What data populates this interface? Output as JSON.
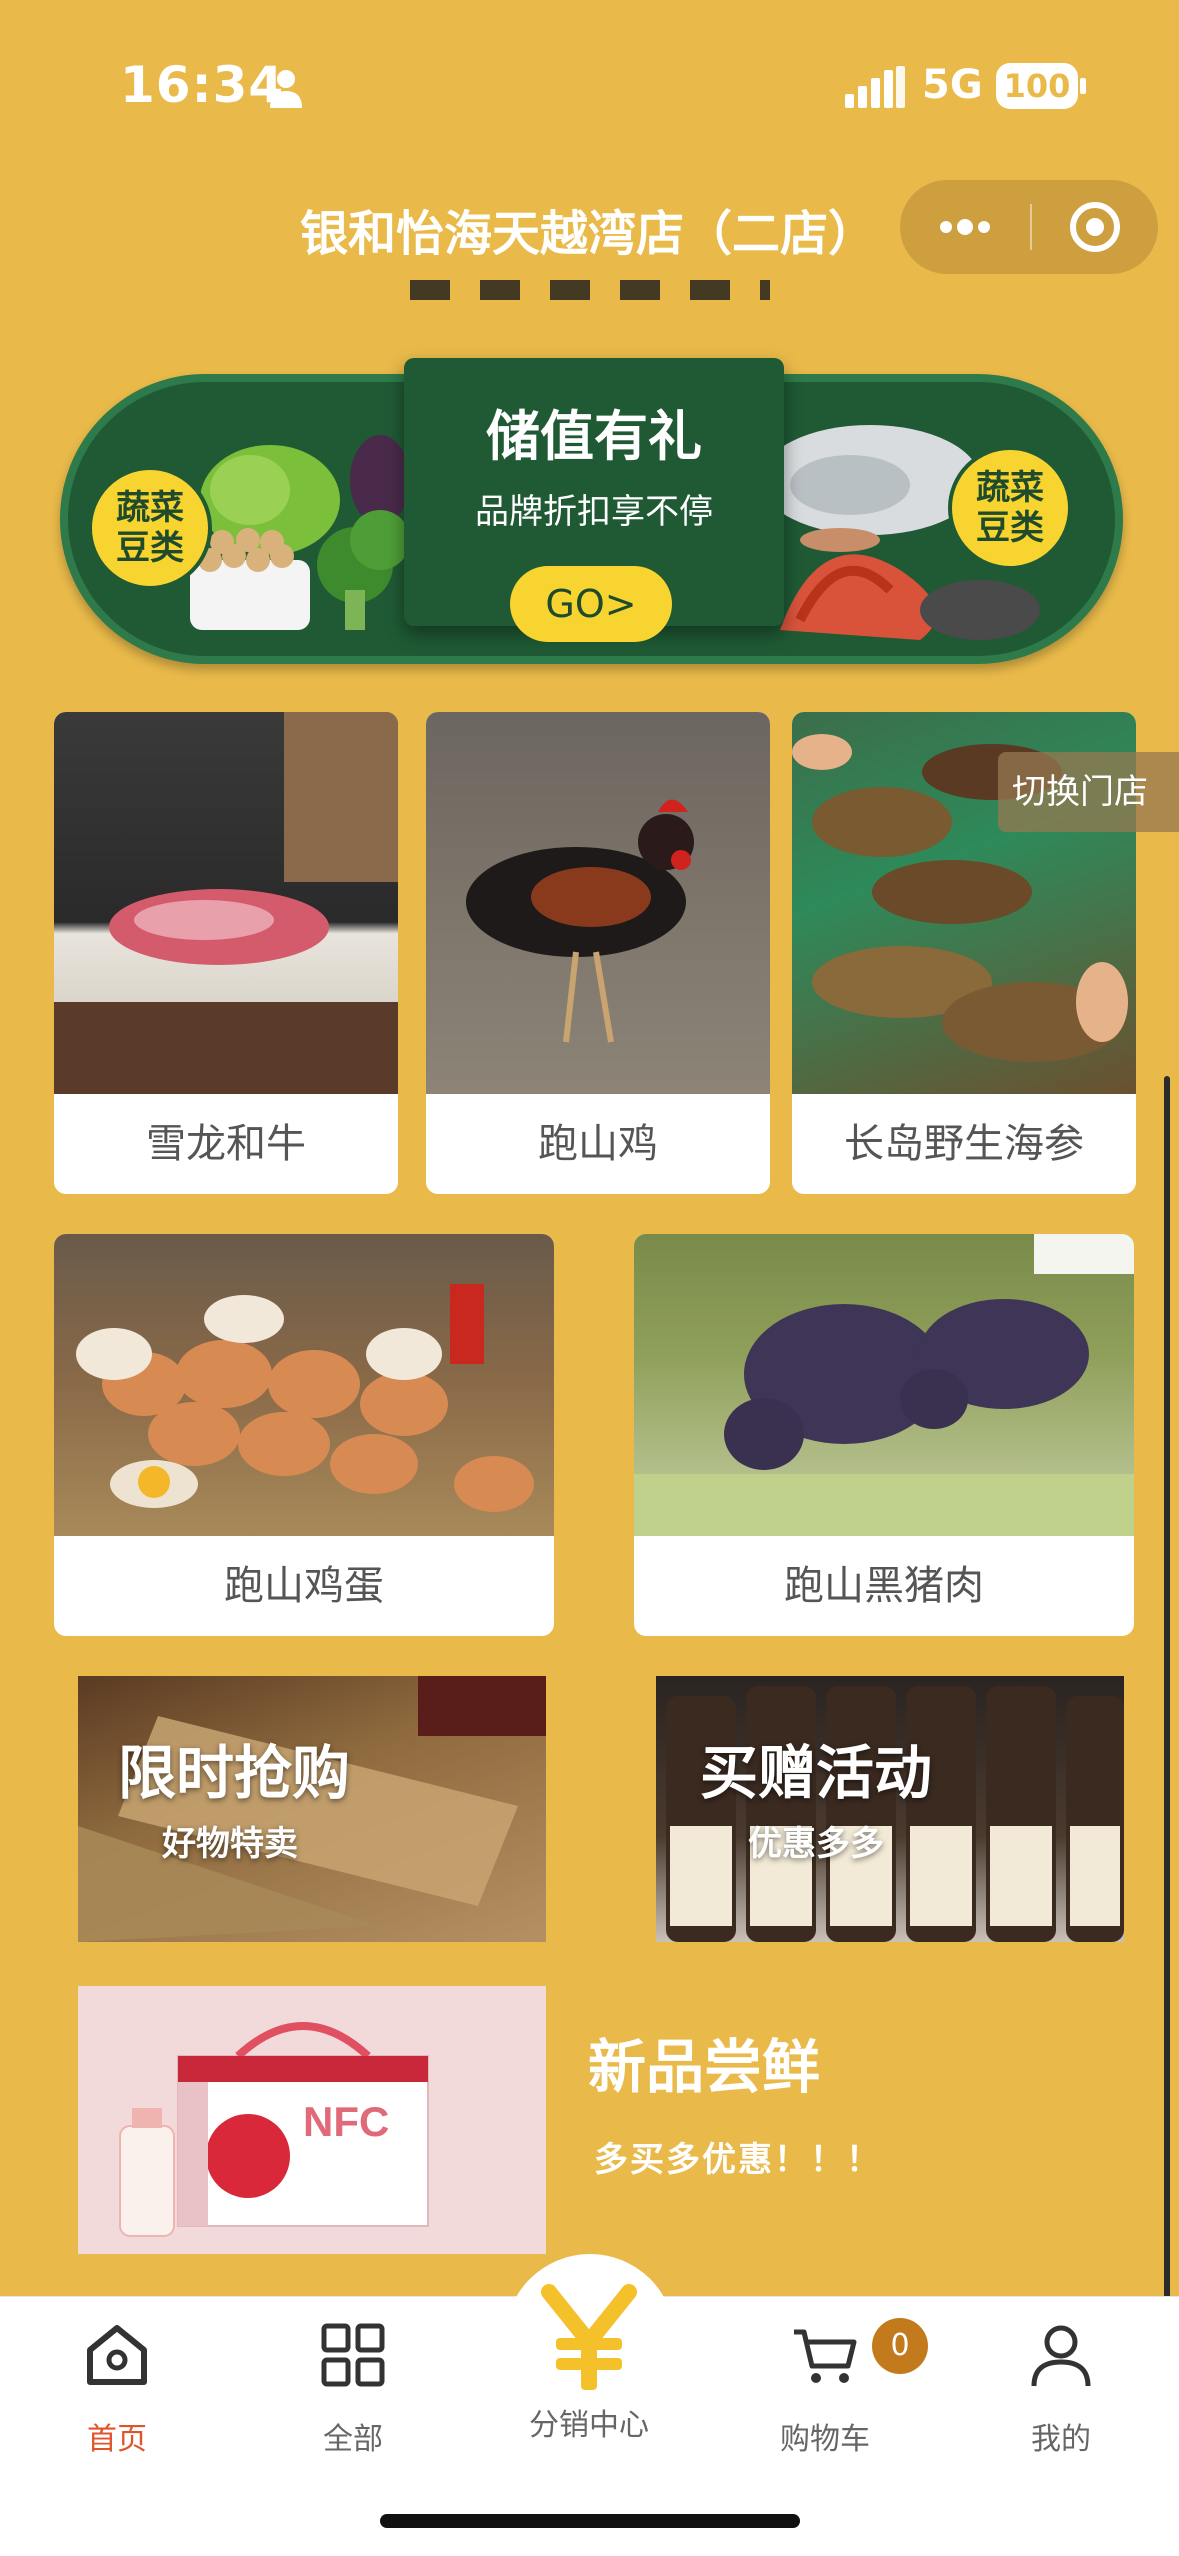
{
  "status_bar": {
    "time": "16:34",
    "network": "5G",
    "battery": "100"
  },
  "header": {
    "store_name": "银和怡海天越湾店（二店）"
  },
  "banner": {
    "title": "储值有礼",
    "subtitle": "品牌折扣享不停",
    "button": "GO>",
    "left_badge": "蔬菜豆类",
    "right_badge": "蔬菜豆类"
  },
  "switch_store": "切换门店",
  "products_row1": [
    {
      "label": "雪龙和牛"
    },
    {
      "label": "跑山鸡"
    },
    {
      "label": "长岛野生海参"
    }
  ],
  "products_row2": [
    {
      "label": "跑山鸡蛋"
    },
    {
      "label": "跑山黑猪肉"
    }
  ],
  "promos": {
    "flash_sale": {
      "title": "限时抢购",
      "subtitle": "好物特卖"
    },
    "gift_event": {
      "title": "买赠活动",
      "subtitle": "优惠多多"
    }
  },
  "new_product": {
    "title": "新品尝鲜",
    "subtitle": "多买多优惠！！！",
    "package_text": "NFC"
  },
  "tabbar": {
    "items": [
      {
        "label": "首页",
        "icon": "home-icon",
        "active": true
      },
      {
        "label": "全部",
        "icon": "grid-icon",
        "active": false
      },
      {
        "label": "分销中心",
        "icon": "yen-icon",
        "active": false
      },
      {
        "label": "购物车",
        "icon": "cart-icon",
        "active": false
      },
      {
        "label": "我的",
        "icon": "user-icon",
        "active": false
      }
    ],
    "cart_count": "0"
  },
  "colors": {
    "background": "#E9BA4A",
    "banner_green": "#1F5A35",
    "accent_yellow": "#F7D430",
    "active_tab": "#E0542C"
  }
}
